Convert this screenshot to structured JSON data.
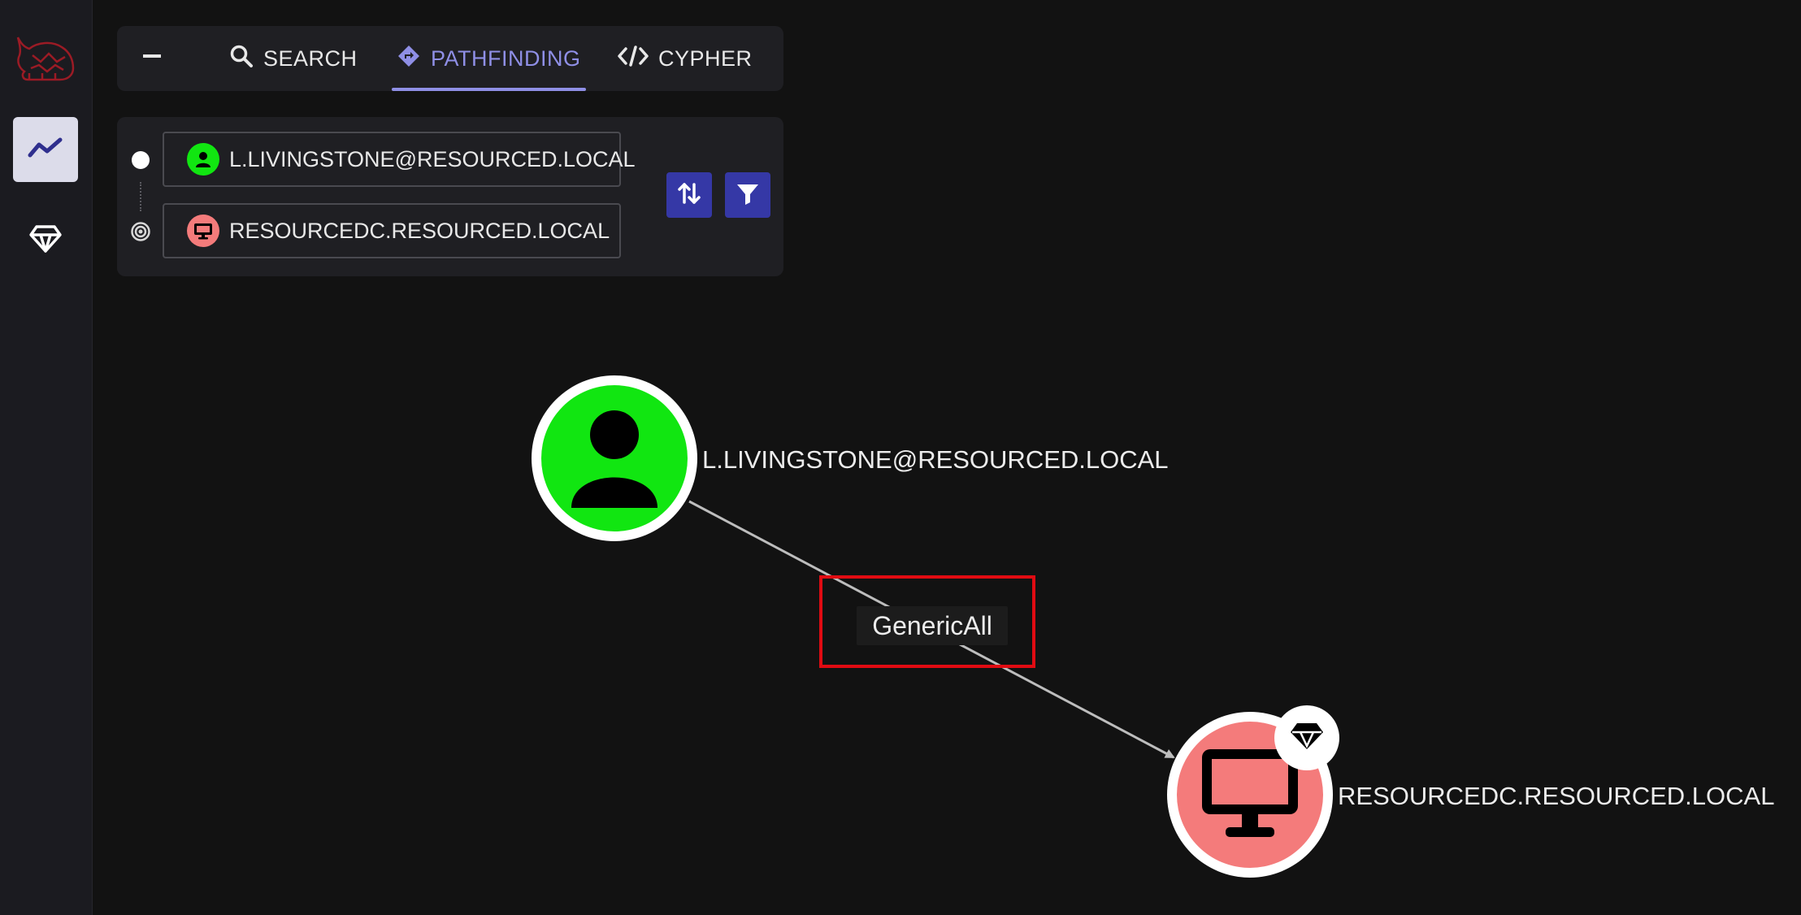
{
  "sidebar": {
    "logo_icon": "bloodhound-dog-logo",
    "items": [
      {
        "icon": "line-chart-icon",
        "active": true
      },
      {
        "icon": "gem-icon",
        "active": false
      }
    ]
  },
  "tabs": {
    "collapse_icon": "minus-icon",
    "items": [
      {
        "label": "SEARCH",
        "icon": "search-icon"
      },
      {
        "label": "PATHFINDING",
        "icon": "diamond-route-icon",
        "active": true
      },
      {
        "label": "CYPHER",
        "icon": "code-icon"
      }
    ]
  },
  "pathfinding": {
    "start_node": "L.LIVINGSTONE@RESOURCED.LOCAL",
    "end_node": "RESOURCEDC.RESOURCED.LOCAL",
    "swap_icon": "swap-vertical-icon",
    "filter_icon": "filter-icon"
  },
  "graph": {
    "source_label": "L.LIVINGSTONE@RESOURCED.LOCAL",
    "target_label": "RESOURCEDC.RESOURCED.LOCAL",
    "edge_label": "GenericAll"
  },
  "colors": {
    "accent": "#8f8fe6",
    "button": "#3538a6",
    "user_node": "#11e611",
    "computer_node": "#f47b7b",
    "highlight": "#e00b12"
  }
}
